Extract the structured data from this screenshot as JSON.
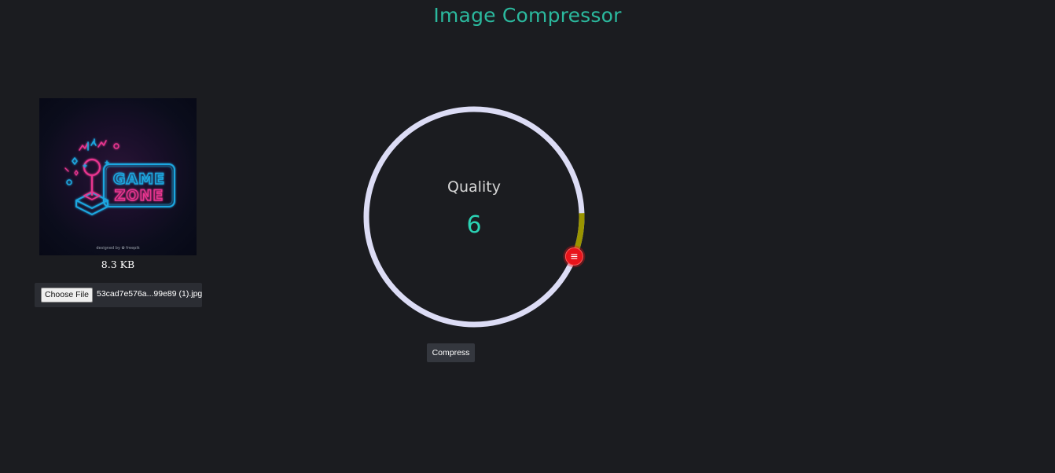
{
  "app": {
    "title": "Image Compressor"
  },
  "preview": {
    "image_icon": "game-zone-neon-image",
    "image_text_line1": "GAME",
    "image_text_line2": "ZONE",
    "image_credit": "designed by ✿ freepik",
    "file_size": "8.3 KB"
  },
  "file_input": {
    "button_label": "Choose File",
    "file_name": "53cad7e576a...99e89 (1).jpg"
  },
  "quality_dial": {
    "label": "Quality",
    "value": "6",
    "level_fraction": 0.06,
    "ring_color": "#dcdcf5",
    "progress_color": "#9a9400",
    "handle_color": "#e8141b",
    "handle_icon": "menu-lines-icon"
  },
  "actions": {
    "compress_label": "Compress"
  },
  "colors": {
    "background": "#1b1c20",
    "accent": "#2bb99e",
    "value": "#2bd2b4"
  }
}
